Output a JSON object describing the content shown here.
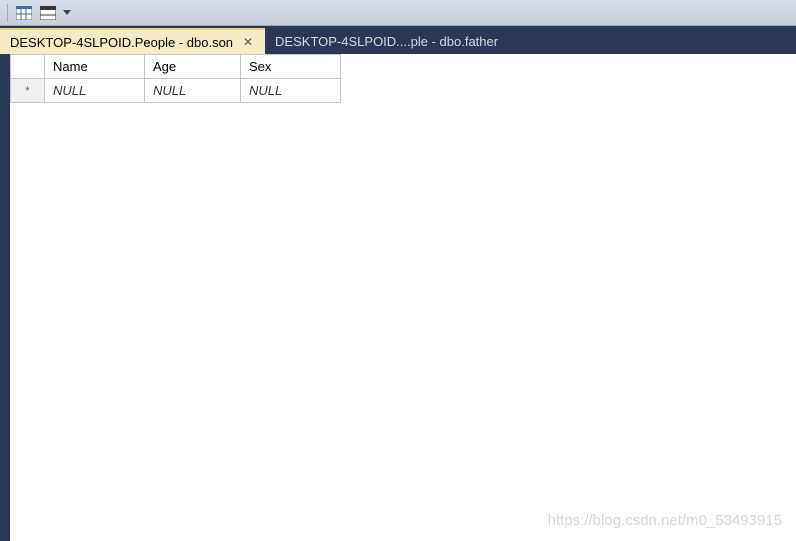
{
  "toolbar": {
    "icons": [
      "divider",
      "grid-icon",
      "table-icon",
      "dropdown"
    ]
  },
  "tabs": [
    {
      "label": "DESKTOP-4SLPOID.People - dbo.son",
      "active": true,
      "closeable": true
    },
    {
      "label": "DESKTOP-4SLPOID....ple - dbo.father",
      "active": false,
      "closeable": false
    }
  ],
  "grid": {
    "columns": [
      "Name",
      "Age",
      "Sex"
    ],
    "rows": [
      {
        "marker": "*",
        "cells": [
          "NULL",
          "NULL",
          "NULL"
        ]
      }
    ]
  },
  "watermark": "https://blog.csdn.net/m0_53493915"
}
